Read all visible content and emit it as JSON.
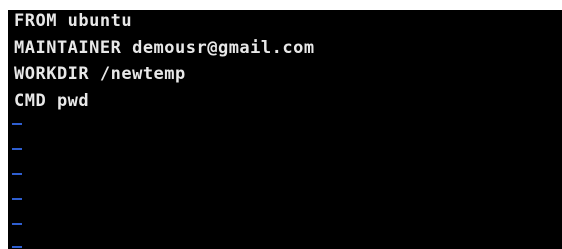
{
  "editor": {
    "lines": [
      "FROM ubuntu",
      "MAINTAINER demousr@gmail.com",
      "WORKDIR /newtemp",
      "CMD pwd"
    ],
    "empty_line_markers": 6,
    "colors": {
      "background": "#000000",
      "text": "#e8e8e8",
      "empty_marker": "#2f5fd0"
    }
  }
}
